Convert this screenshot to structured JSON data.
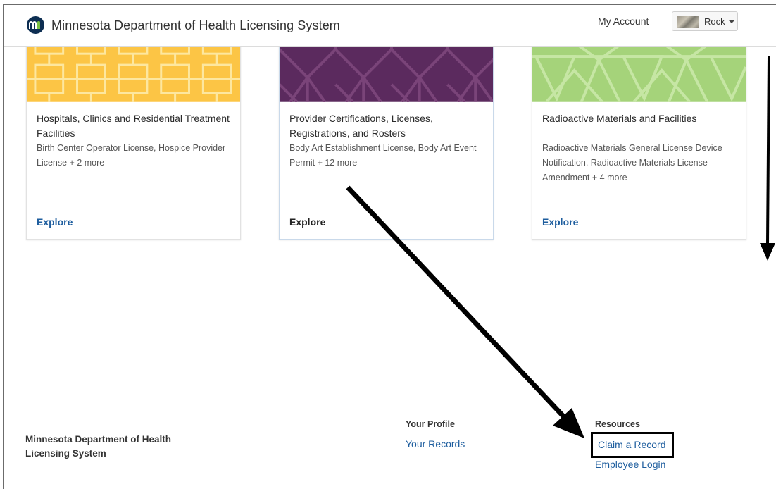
{
  "header": {
    "title": "Minnesota Department of Health Licensing System",
    "my_account": "My Account",
    "user_name": "Rock"
  },
  "cards": [
    {
      "title": "Hospitals, Clinics and Residential Treatment Facilities",
      "description": "Birth Center Operator License, Hospice Provider License + 2 more",
      "link": "Explore",
      "banner_color": "#fcc545"
    },
    {
      "title": "Provider Certifications, Licenses, Registrations, and Rosters",
      "description": "Body Art Establishment License, Body Art Event Permit + 12 more",
      "link": "Explore",
      "banner_color": "#5b2a5e"
    },
    {
      "title": "Radioactive Materials and Facilities",
      "description": "Radioactive Materials General License Device Notification, Radioactive Materials License Amendment + 4 more",
      "link": "Explore",
      "banner_color": "#a5d37a"
    }
  ],
  "footer": {
    "org_name": "Minnesota Department of Health Licensing System",
    "profile_heading": "Your Profile",
    "your_records": "Your Records",
    "resources_heading": "Resources",
    "claim_record": "Claim a Record",
    "employee_login": "Employee Login"
  },
  "colors": {
    "link": "#1d5d9e",
    "logo_navy": "#0d2e52",
    "logo_green": "#79c143"
  },
  "annotations": [
    "arrow-to-claim-a-record",
    "arrow-scroll-down",
    "highlight-box-claim-a-record"
  ]
}
